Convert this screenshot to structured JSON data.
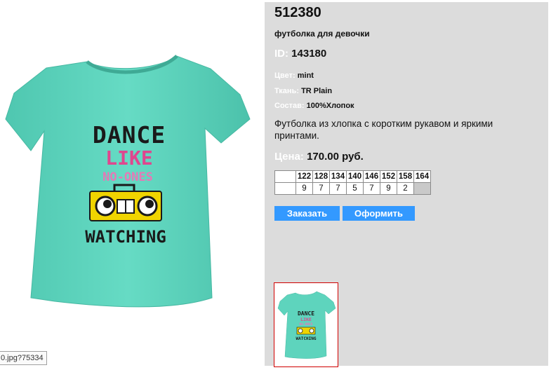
{
  "product": {
    "sku": "512380",
    "subtitle": "футболка для девочки",
    "id_label": "ID:",
    "id_value": "143180",
    "color_label": "Цвет:",
    "color_value": "mint",
    "fabric_label": "Ткань:",
    "fabric_value": "TR Plain",
    "composition_label": "Состав:",
    "composition_value": "100%Хлопок",
    "description": "Футболка из хлопка с коротким рукавом и яркими принтами.",
    "price_label": "Цена:",
    "price_value": "170.00 руб."
  },
  "image": {
    "print_lines": [
      "DANCE",
      "LIKE",
      "NO-ONES",
      "WATCHING"
    ],
    "shirt_color": "#5ed4bd",
    "filename_tooltip": "0.jpg?75334"
  },
  "sizes": {
    "headers": [
      "122",
      "128",
      "134",
      "140",
      "146",
      "152",
      "158",
      "164"
    ],
    "quantities": [
      "9",
      "7",
      "7",
      "5",
      "7",
      "9",
      "2",
      ""
    ]
  },
  "buttons": {
    "order": "Заказать",
    "checkout": "Оформить"
  },
  "colors": {
    "panel_bg": "#dcdcdc",
    "button_bg": "#3399ff",
    "thumb_border": "#d00000"
  }
}
